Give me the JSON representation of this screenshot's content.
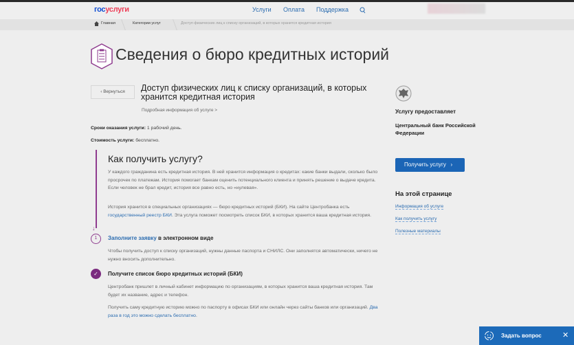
{
  "header": {
    "logo_part1": "гос",
    "logo_part2": "услуги",
    "nav": [
      "Услуги",
      "Оплата",
      "Поддержка"
    ]
  },
  "breadcrumb": [
    "Главная",
    "Категории услуг",
    "Доступ физических лиц к списку организаций, в которых хранится кредитная история"
  ],
  "page_title": "Сведения о бюро кредитных историй",
  "back_label": "Вернуться",
  "service_title": "Доступ физических лиц к списку организаций, в которых хранится кредитная история",
  "details_link": "Подробная информация об услуге",
  "terms": {
    "label": "Сроки оказания услуги:",
    "value": "1 рабочий день."
  },
  "cost": {
    "label": "Стоимость услуги:",
    "value": "бесплатно."
  },
  "how": {
    "heading": "Как получить услугу?",
    "p1": "У каждого гражданина есть кредитная история. В ней хранится информация о кредитах: какие банки выдали, сколько было просрочек по платежам. История помогает банкам оценить потенциального клиента и принять решение о выдаче кредита. Если человек не брал кредит, история все равно есть, но «нулевая».",
    "p2_before": "История хранится в специальных организациях — бюро кредитных историй (БКИ). На сайте Центробанка есть ",
    "p2_link": "государственный реестр БКИ",
    "p2_after": ". Эта услуга поможет посмотреть список БКИ, в которых хранится ваша кредитная история."
  },
  "steps": [
    {
      "number": "1",
      "link": "Заполните заявку",
      "title": " в электронном виде",
      "text": "Чтобы получить доступ к списку организаций, нужны данные паспорта и СНИЛС. Они заполнятся автоматически, ничего не нужно вносить дополнительно."
    },
    {
      "title": "Получите список бюро кредитных историй (БКИ)",
      "text": "Центробанк пришлет в личный кабинет информацию по организациям, в которых хранится ваша кредитная история. Там будет их название, адрес и телефон.",
      "text2": "Получить саму кредитную историю можно по паспорту в офисах БКИ или онлайн через сайты банков или организаций. ",
      "link2": "Два раза в год это можно сделать бесплатно",
      "end": "."
    }
  ],
  "provider": {
    "label": "Услугу предоставляет",
    "name": "Центральный банк Российской Федерации"
  },
  "get_service": "Получить услугу",
  "toc": {
    "heading": "На этой странице",
    "items": [
      "Информация об услуге",
      "Как получить услугу",
      "Полезные материалы"
    ]
  },
  "chat": {
    "label": "Задать вопрос"
  },
  "colors": {
    "accent": "#1b65b6",
    "purple": "#7b2b7f"
  }
}
